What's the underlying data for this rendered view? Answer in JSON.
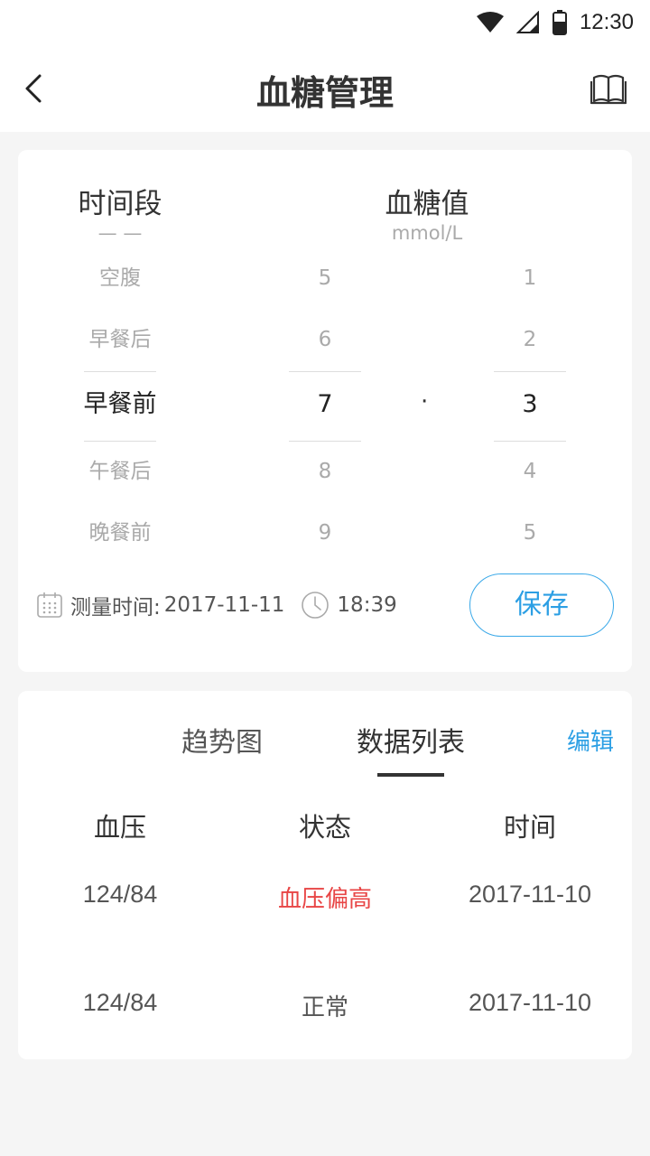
{
  "status_bar": {
    "time": "12:30"
  },
  "header": {
    "title": "血糖管理"
  },
  "entry": {
    "period_label": "时间段",
    "period_unit": "— —",
    "value_label": "血糖值",
    "value_unit": "mmol/L",
    "periods": [
      "空腹",
      "早餐后",
      "早餐前",
      "午餐后",
      "晚餐前"
    ],
    "integer_digits": [
      "5",
      "6",
      "7",
      "8",
      "9"
    ],
    "decimal_separator": "·",
    "decimal_digits": [
      "1",
      "2",
      "3",
      "4",
      "5"
    ],
    "measure_label": "测量时间:",
    "measure_date": "2017-11-11",
    "measure_time": "18:39",
    "save_label": "保存"
  },
  "records": {
    "tabs": [
      "趋势图",
      "数据列表"
    ],
    "active_tab": "数据列表",
    "edit_label": "编辑",
    "columns": [
      "血压",
      "状态",
      "时间"
    ],
    "rows": [
      {
        "pressure": "124/84",
        "status": "血压偏高",
        "date": "2017-11-10",
        "status_color": "#e84545"
      },
      {
        "pressure": "124/84",
        "status": "正常",
        "date": "2017-11-10",
        "status_color": "#555555"
      }
    ]
  },
  "colors": {
    "accent": "#2c9fe4",
    "alert": "#e84545"
  }
}
